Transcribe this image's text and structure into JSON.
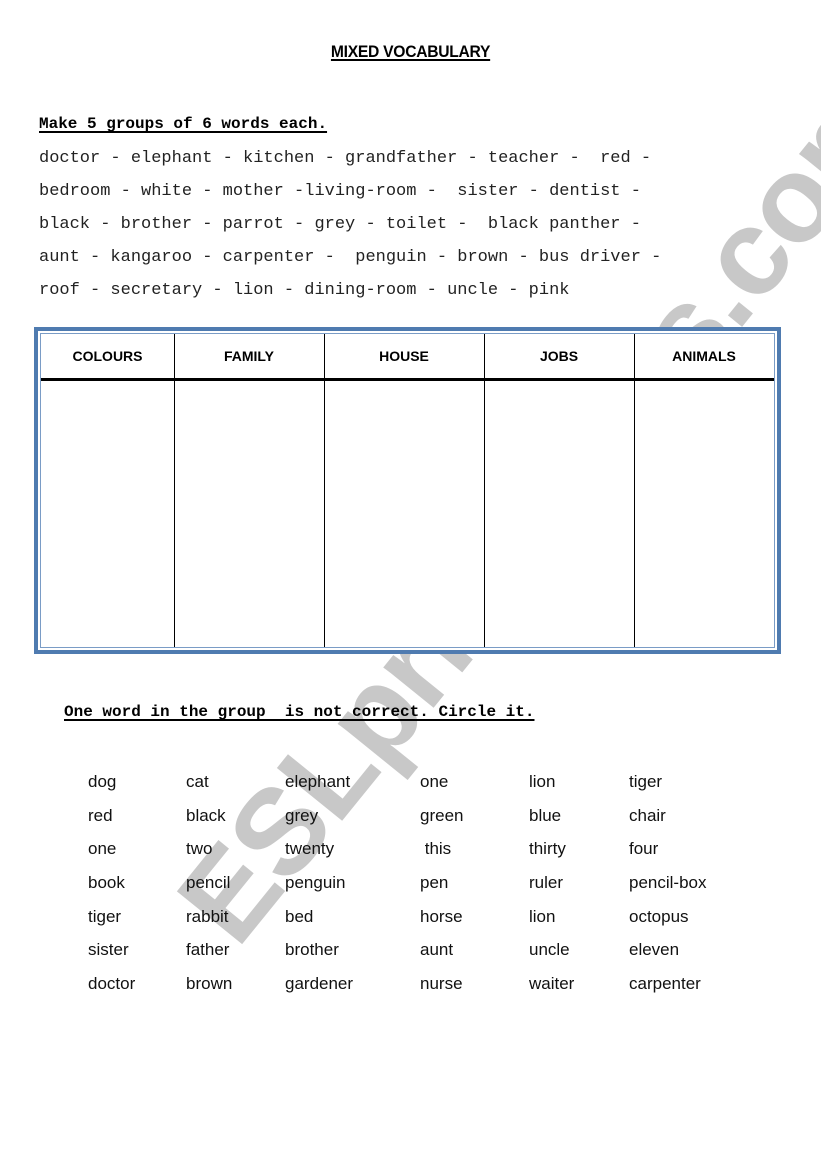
{
  "watermark": "ESLprintables.com",
  "title": "MIXED VOCABULARY",
  "exercise1": {
    "instruction": "Make 5 groups of 6 words each.",
    "word_lines": [
      "doctor - elephant - kitchen - grandfather - teacher -  red -",
      "bedroom - white - mother -living-room -  sister - dentist -",
      "black - brother - parrot - grey - toilet -  black panther -",
      "aunt - kangaroo - carpenter -  penguin - brown - bus driver -",
      "roof - secretary - lion - dining-room - uncle - pink"
    ],
    "table_headers": [
      "COLOURS",
      "FAMILY",
      "HOUSE",
      "JOBS",
      "ANIMALS"
    ]
  },
  "exercise2": {
    "instruction": "One word in the group  is not correct. Circle it.",
    "rows": [
      [
        "dog",
        "cat",
        "elephant",
        "one",
        "lion",
        "tiger"
      ],
      [
        "red",
        "black",
        "grey",
        "green",
        "blue",
        "chair"
      ],
      [
        "one",
        "two",
        "twenty",
        " this",
        "thirty",
        "four"
      ],
      [
        "book",
        "pencil",
        "penguin",
        "pen",
        "ruler",
        "pencil-box"
      ],
      [
        "tiger",
        "rabbit",
        "bed",
        "horse",
        "lion",
        "octopus"
      ],
      [
        "sister",
        "father",
        "brother",
        "aunt",
        "uncle",
        "eleven"
      ],
      [
        "doctor",
        "brown",
        "gardener",
        "nurse",
        "waiter",
        "carpenter"
      ]
    ]
  },
  "colors": {
    "table_border": "#4f7bb0",
    "watermark": "#c8c8c8"
  }
}
